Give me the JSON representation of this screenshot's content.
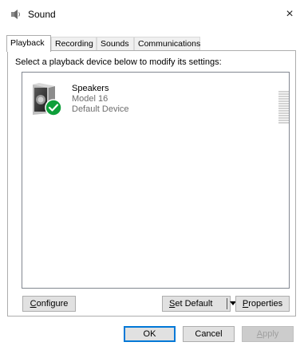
{
  "window": {
    "title": "Sound",
    "close_glyph": "×",
    "title_icon": "speaker-icon"
  },
  "tabs": [
    {
      "label": "Playback",
      "active": true
    },
    {
      "label": "Recording",
      "active": false
    },
    {
      "label": "Sounds",
      "active": false
    },
    {
      "label": "Communications",
      "active": false
    }
  ],
  "instruction": "Select a playback device below to modify its settings:",
  "devices": [
    {
      "name": "Speakers",
      "model": "Model 16",
      "status": "Default Device",
      "icon": "speaker-icon",
      "badge": "green-check-icon"
    }
  ],
  "buttons": {
    "configure": {
      "underline": "C",
      "rest": "onfigure"
    },
    "set_default": {
      "underline": "S",
      "rest": "et Default"
    },
    "properties": {
      "underline": "P",
      "rest": "roperties"
    },
    "ok": "OK",
    "cancel": "Cancel",
    "apply": {
      "underline": "A",
      "rest": "pply"
    }
  },
  "colors": {
    "accent": "#0078d7",
    "badge_green": "#0e9f3a",
    "level_meter": "#d3d3d3"
  }
}
